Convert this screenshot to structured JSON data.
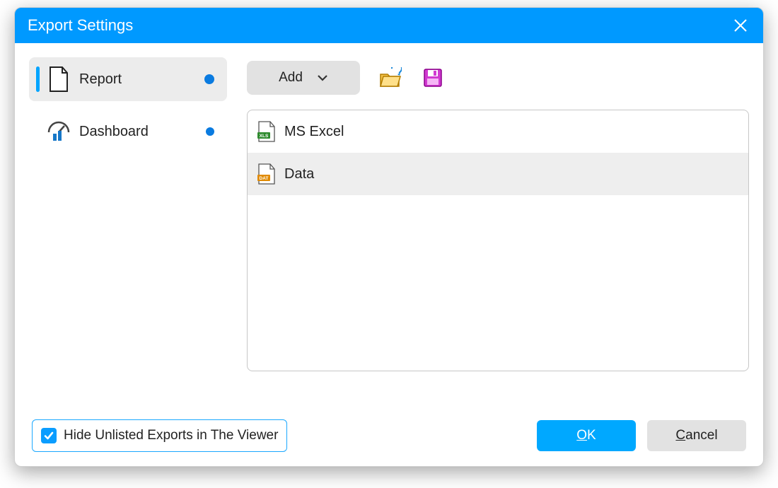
{
  "window": {
    "title": "Export Settings"
  },
  "sidebar": {
    "items": [
      {
        "label": "Report",
        "selected": true,
        "icon": "page",
        "dot": true
      },
      {
        "label": "Dashboard",
        "selected": false,
        "icon": "gauge",
        "dot": true
      }
    ]
  },
  "toolbar": {
    "add_label": "Add"
  },
  "list": {
    "items": [
      {
        "label": "MS Excel",
        "ext": "XLS",
        "color": "#2e8b2e",
        "selected": false
      },
      {
        "label": "Data",
        "ext": "DAT",
        "color": "#e08a00",
        "selected": true
      }
    ]
  },
  "footer": {
    "checkbox_label": "Hide Unlisted Exports in The Viewer",
    "checkbox_checked": true,
    "ok_label": "OK",
    "cancel_label": "Cancel"
  }
}
